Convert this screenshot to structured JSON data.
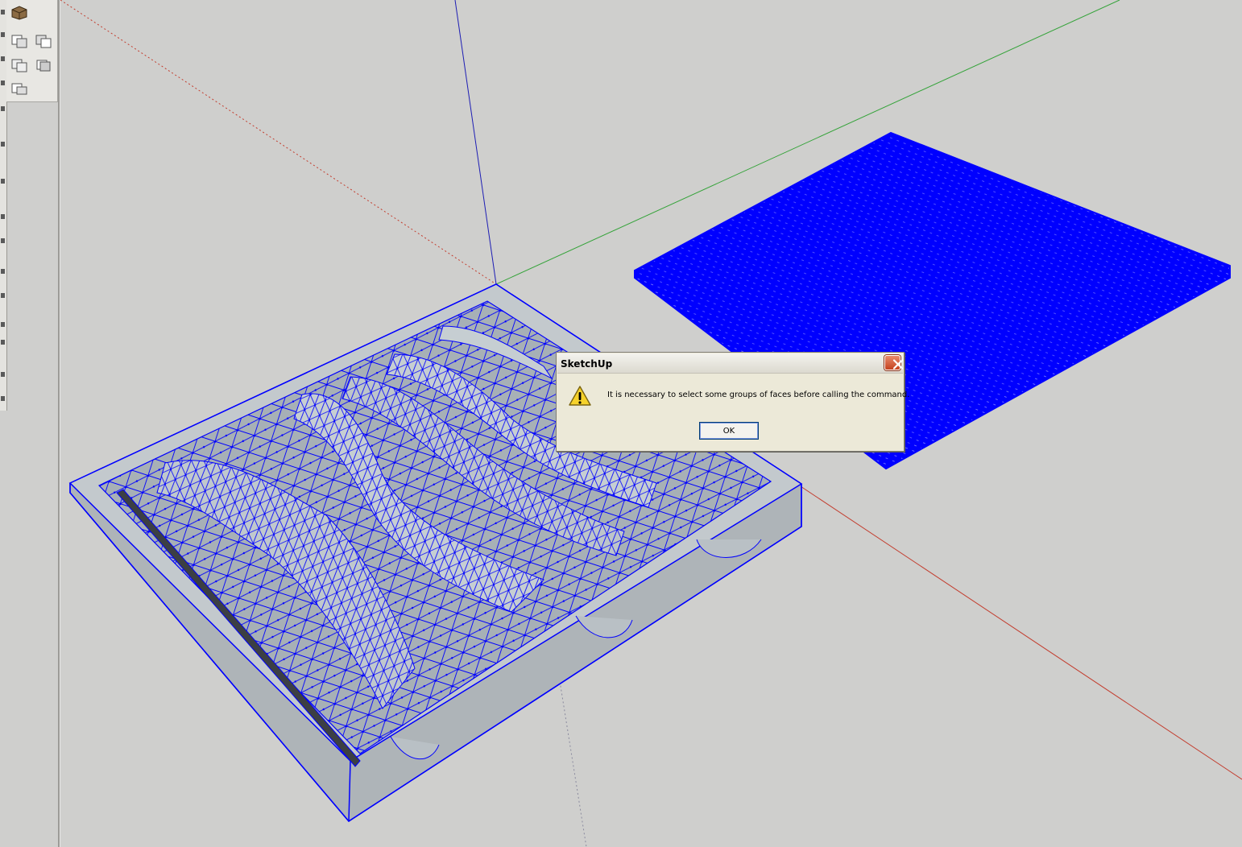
{
  "app": {
    "name": "SketchUp"
  },
  "toolbar": {
    "tools": [
      {
        "icon": "component-icon"
      },
      {
        "icon": "intersect-faces-icon"
      },
      {
        "icon": "subtract-faces-icon"
      },
      {
        "icon": "union-faces-icon"
      },
      {
        "icon": "split-faces-icon"
      },
      {
        "icon": "outer-shell-icon"
      },
      {
        "icon": "trim-icon"
      }
    ]
  },
  "scene": {
    "axis_colors": {
      "red": "#c33d2e",
      "green": "#35a33a",
      "blue": "#1e1eb4"
    },
    "wire_color": "#0000ff",
    "surface_color": "#b6bec4",
    "background": "#cfcfcd"
  },
  "dialog": {
    "title": "SketchUp",
    "message": "It is necessary to select some groups of faces before calling the command.",
    "ok_label": "OK",
    "icon": "warning-icon"
  }
}
